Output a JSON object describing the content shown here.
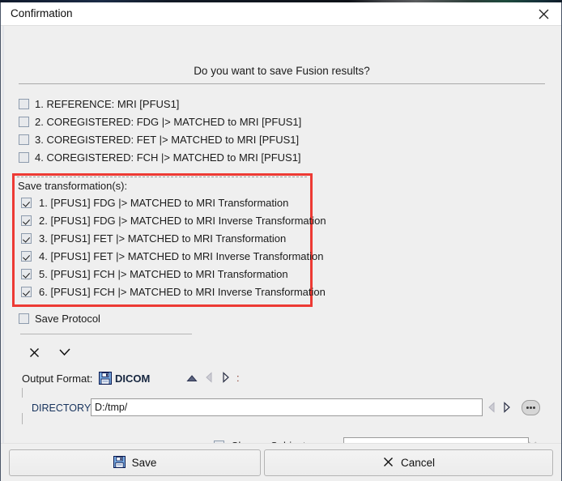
{
  "window": {
    "title": "Confirmation",
    "close_icon": "close-icon"
  },
  "prompt": "Do you want to save Fusion results?",
  "series_checkboxes": [
    {
      "checked": false,
      "label": "1. REFERENCE: MRI [PFUS1]"
    },
    {
      "checked": false,
      "label": "2. COREGISTERED: FDG |> MATCHED to MRI [PFUS1]"
    },
    {
      "checked": false,
      "label": "3. COREGISTERED: FET |> MATCHED to MRI [PFUS1]"
    },
    {
      "checked": false,
      "label": "4. COREGISTERED: FCH |> MATCHED to MRI [PFUS1]"
    }
  ],
  "transformations": {
    "title": "Save transformation(s):",
    "highlight_color": "#ed3a34",
    "items": [
      {
        "checked": true,
        "label": "1. [PFUS1] FDG |> MATCHED to MRI Transformation"
      },
      {
        "checked": true,
        "label": "2. [PFUS1] FDG |> MATCHED to MRI Inverse Transformation"
      },
      {
        "checked": true,
        "label": "3. [PFUS1] FET |> MATCHED to MRI Transformation"
      },
      {
        "checked": true,
        "label": "4. [PFUS1] FET |> MATCHED to MRI Inverse Transformation"
      },
      {
        "checked": true,
        "label": "5. [PFUS1] FCH |> MATCHED to MRI Transformation"
      },
      {
        "checked": true,
        "label": "6. [PFUS1] FCH |> MATCHED to MRI Inverse Transformation"
      }
    ]
  },
  "save_protocol": {
    "checked": false,
    "label": "Save Protocol"
  },
  "quick_actions": {
    "deselect_all_icon": "x-icon",
    "select_all_icon": "check-icon"
  },
  "output_format": {
    "label": "Output Format:",
    "icon": "floppy-disk-icon",
    "value": "DICOM",
    "nav_up_icon": "triangle-up-icon",
    "nav_prev_icon": "triangle-left-icon",
    "nav_next_icon": "triangle-right-icon",
    "separator": ":"
  },
  "directory": {
    "label": "DIRECTORY",
    "value": "D:/tmp/",
    "placeholder": "",
    "prev_icon": "triangle-left-icon",
    "next_icon": "triangle-right-icon",
    "browse_icon": "ellipsis-button-icon"
  },
  "change_subject": {
    "checked": false,
    "label": "Change Subject name",
    "value": "",
    "placeholder": "",
    "clear_icon": "x-icon"
  },
  "footer": {
    "save_label": "Save",
    "save_icon": "floppy-disk-icon",
    "cancel_label": "Cancel",
    "cancel_icon": "x-icon"
  }
}
